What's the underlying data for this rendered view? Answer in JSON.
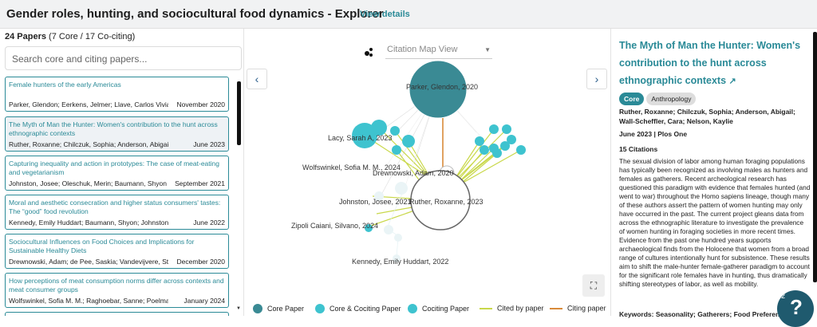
{
  "header": {
    "title": "Gender roles, hunting, and sociocultural food dynamics - Explorer",
    "details_link": "View details"
  },
  "sidebar": {
    "count_bold": "24 Papers",
    "count_rest": " (7 Core / 17 Co-citing)",
    "search_placeholder": "Search core and citing papers...",
    "papers": [
      {
        "title": "Female hunters of the early Americas",
        "authors": "Parker, Glendon; Eerkens, Jelmer; Llave, Carlos Vivian...",
        "date": "November 2020"
      },
      {
        "title": "The Myth of Man the Hunter: Women's contribution to the hunt across ethnographic contexts",
        "authors": "Ruther, Roxanne; Chilczuk, Sophia; Anderson, Abigail; Wall-...",
        "date": "June 2023"
      },
      {
        "title": "Capturing inequality and action in prototypes: The case of meat-eating and vegetarianism",
        "authors": "Johnston, Josee; Oleschuk, Merin; Baumann, Shyon",
        "date": "September 2021"
      },
      {
        "title": "Moral and aesthetic consecration and higher status consumers' tastes: The “good” food revolution",
        "authors": "Kennedy, Emily Huddart; Baumann, Shyon; Johnston, Josee",
        "date": "June 2022"
      },
      {
        "title": "Sociocultural Influences on Food Choices and Implications for Sustainable Healthy Diets",
        "authors": "Drewnowski, Adam; de Pee, Saskia; Vandevijvere, Stef...",
        "date": "December 2020"
      },
      {
        "title": "How perceptions of meat consumption norms differ across contexts and meat consumer groups",
        "authors": "Wolfswinkel, Sofia M. M.; Raghoebar, Sanne; Poelman, M...",
        "date": "January 2024"
      }
    ]
  },
  "map": {
    "view_label": "Citation Map View",
    "nodes": [
      {
        "label": "Parker, Glendon, 2020"
      },
      {
        "label": "Lacy, Sarah A, 2023"
      },
      {
        "label": "Wolfswinkel, Sofia M. M., 2024"
      },
      {
        "label": "Drewnowski, Adam, 2020"
      },
      {
        "label": "Johnston, Josee, 2021"
      },
      {
        "label": "Ruther, Roxanne, 2023"
      },
      {
        "label": "Zipoli Caiani, Silvano, 2024"
      },
      {
        "label": "Kennedy, Emily Huddart, 2022"
      }
    ],
    "legend": [
      {
        "label": "Core Paper",
        "color": "#3a8a94"
      },
      {
        "label": "Core & Cociting Paper",
        "color": "#3ec3cf"
      },
      {
        "label": "Cociting Paper",
        "color": "#3ec3cf"
      },
      {
        "label": "Cited by paper",
        "color": "#c9d84a"
      },
      {
        "label": "Citing paper",
        "color": "#d98a3a"
      }
    ]
  },
  "detail": {
    "title": "The Myth of Man the Hunter: Women's contribution to the hunt across ethnographic contexts",
    "tags": [
      "Core",
      "Anthropology"
    ],
    "authors": "Ruther, Roxanne; Chilczuk, Sophia; Anderson, Abigail; Wall-Scheffler, Cara; Nelson, Kaylie",
    "date_journal": "June 2023 | Plos One",
    "citations": "15 Citations",
    "abstract": "The sexual division of labor among human foraging populations has typically been recognized as involving males as hunters and females as gatherers. Recent archeological research has questioned this paradigm with evidence that females hunted (and went to war) throughout the Homo sapiens lineage, though many of these authors assert the pattern of women hunting may only have occurred in the past. The current project gleans data from across the ethnographic literature to investigate the prevalence of women hunting in foraging societies in more recent times. Evidence from the past one hundred years supports archaeological finds from the Holocene that women from a broad range of cultures intentionally hunt for subsistence. These results aim to shift the male-hunter female-gatherer paradigm to account for the significant role females have in hunting, thus dramatically shifting stereotypes of labor, as well as mobility.",
    "keywords": "Keywords: Seasonality; Gatherers; Food Preferenc..."
  },
  "help": {
    "badge": "2",
    "icon": "?"
  }
}
